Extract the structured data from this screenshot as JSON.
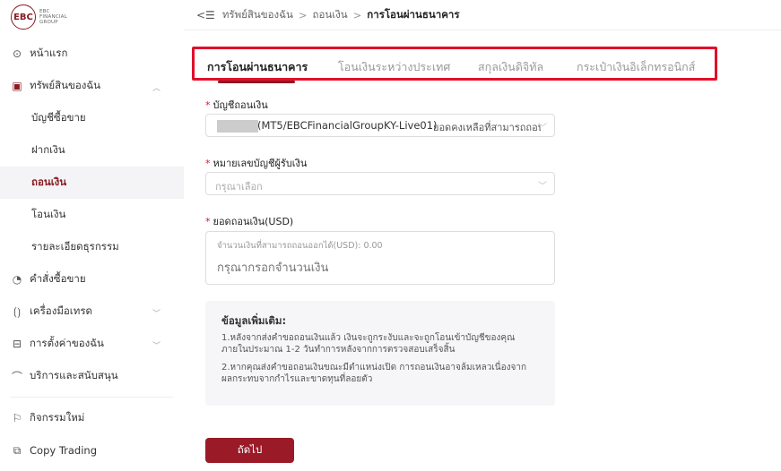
{
  "logo": {
    "mark": "EBC",
    "line1": "EBC",
    "line2": "FINANCIAL",
    "line3": "GROUP"
  },
  "sidebar": {
    "items": [
      {
        "label": "หน้าแรก",
        "icon": "home-icon"
      },
      {
        "label": "ทรัพย์สินของฉัน",
        "icon": "wallet-icon"
      },
      {
        "label": "บัญชีซื้อขาย"
      },
      {
        "label": "ฝากเงิน"
      },
      {
        "label": "ถอนเงิน"
      },
      {
        "label": "โอนเงิน"
      },
      {
        "label": "รายละเอียดธุรกรรม"
      },
      {
        "label": "คำสั่งซื้อขาย",
        "icon": "orders-icon"
      },
      {
        "label": "เครื่องมือเทรด",
        "icon": "tools-icon"
      },
      {
        "label": "การตั้งค่าของฉัน",
        "icon": "settings-icon"
      },
      {
        "label": "บริการและสนับสนุน",
        "icon": "support-icon"
      },
      {
        "label": "กิจกรรมใหม่",
        "icon": "flag-icon"
      },
      {
        "label": "Copy Trading",
        "icon": "copy-trading-icon"
      }
    ]
  },
  "breadcrumb": {
    "items": [
      "ทรัพย์สินของฉัน",
      "ถอนเงิน",
      "การโอนผ่านธนาคาร"
    ],
    "separator": ">"
  },
  "tabs": [
    "การโอนผ่านธนาคาร",
    "โอนเงินระหว่างประเทศ",
    "สกุลเงินดิจิทัล",
    "กระเป๋าเงินอิเล็กทรอนิกส์"
  ],
  "form": {
    "account_label": "บัญชีถอนเงิน",
    "account_value": "(MT5/EBCFinancialGroupKY-Live01)",
    "account_balance": "ยอดคงเหลือที่สามารถถอนได้",
    "recipient_label": "หมายเลขบัญชีผู้รับเงิน",
    "recipient_placeholder": "กรุณาเลือก",
    "amount_label": "ยอดถอนเงิน(USD)",
    "amount_available": "จำนวนเงินที่สามารถถอนออกได้(USD): 0.00",
    "amount_placeholder": "กรุณากรอกจำนวนเงิน",
    "required_mark": "*"
  },
  "info": {
    "title": "ข้อมูลเพิ่มเติม:",
    "p1": "1.หลังจากส่งคำขอถอนเงินแล้ว เงินจะถูกระงับและจะถูกโอนเข้าบัญชีของคุณภายในประมาณ 1-2 วันทำการหลังจากการตรวจสอบเสร็จสิ้น",
    "p2": "2.หากคุณส่งคำขอถอนเงินขณะมีตำแหน่งเปิด การถอนเงินอาจล้มเหลวเนื่องจากผลกระทบจากกำไรและขาดทุนที่ลอยตัว"
  },
  "next_button": "ถัดไป",
  "colors": {
    "brand": "#8b1a24",
    "highlight_border": "#e0102a",
    "button": "#9b1a28"
  }
}
